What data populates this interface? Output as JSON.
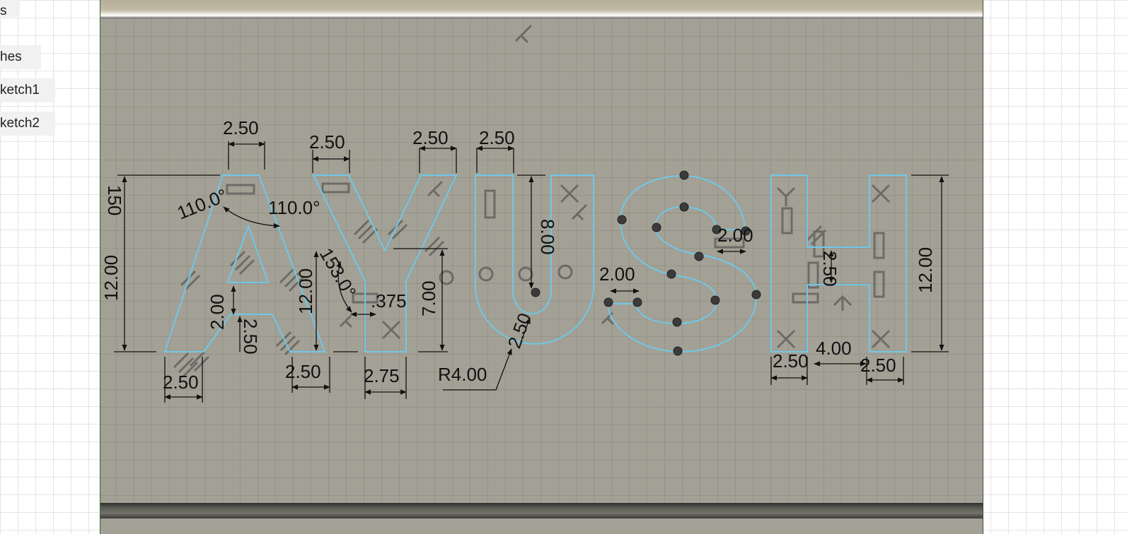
{
  "browser": {
    "items": [
      {
        "label": "s"
      },
      {
        "label": "hes"
      },
      {
        "label": "ketch1"
      },
      {
        "label": "ketch2"
      }
    ]
  },
  "sketch": {
    "text": "AYUSH",
    "profile_color": "#6fc8e8",
    "dimensions": [
      "2.50",
      "2.50",
      "2.50",
      "2.50",
      "110.0°",
      "110.0°",
      "150",
      "12.00",
      "2.00",
      "2.50",
      "12.00",
      "2.50",
      "2.50",
      "153.0°",
      ".375",
      "7.00",
      "2.75",
      "8.00",
      "2.50",
      "R4.00",
      "2.00",
      "2.00",
      "2.50",
      "12.00",
      "2.50",
      "4.00",
      "2.50"
    ]
  }
}
